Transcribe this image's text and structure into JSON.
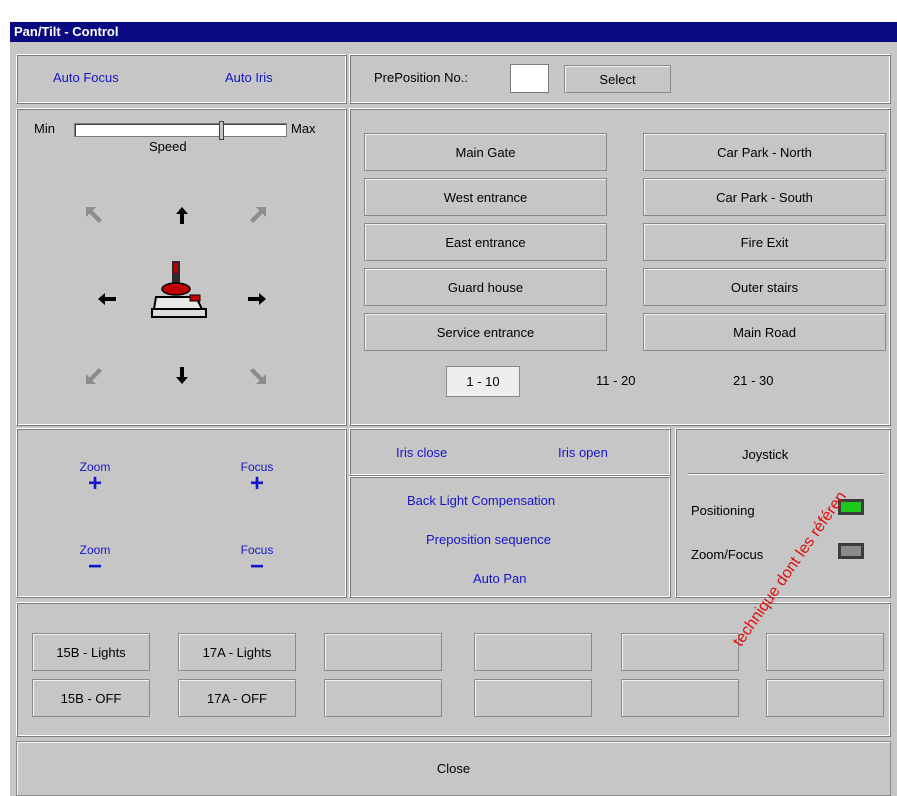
{
  "window": {
    "title": "Pan/Tilt - Control"
  },
  "top_left": {
    "auto_focus": "Auto Focus",
    "auto_iris": "Auto Iris"
  },
  "preposition": {
    "label": "PrePosition No.:",
    "value": "",
    "select": "Select"
  },
  "speed": {
    "min": "Min",
    "max": "Max",
    "label": "Speed",
    "level": 0.7
  },
  "direction_icons": [
    "arrow-up-left-icon",
    "arrow-up-icon",
    "arrow-up-right-icon",
    "arrow-left-icon",
    "joystick-icon",
    "arrow-right-icon",
    "arrow-down-left-icon",
    "arrow-down-icon",
    "arrow-down-right-icon"
  ],
  "presets": {
    "left": [
      "Main Gate",
      "West entrance",
      "East entrance",
      "Guard house",
      "Service entrance"
    ],
    "right": [
      "Car Park - North",
      "Car Park - South",
      "Fire Exit",
      "Outer stairs",
      "Main Road"
    ],
    "pages": [
      "1 - 10",
      "11 - 20",
      "21 - 30"
    ],
    "active_page": "1 - 10"
  },
  "zoom_focus": {
    "zoom": "Zoom",
    "focus": "Focus",
    "plus": "+",
    "minus": "−"
  },
  "iris": {
    "close": "Iris close",
    "open": "Iris open"
  },
  "functions": {
    "blc": "Back Light Compensation",
    "sequence": "Preposition sequence",
    "autopan": "Auto Pan"
  },
  "joystick": {
    "title": "Joystick",
    "positioning": "Positioning",
    "zoom_focus": "Zoom/Focus",
    "positioning_on": true,
    "zoom_focus_on": false,
    "colors": {
      "on": "#1ec81e",
      "off": "#8a8a8a"
    }
  },
  "aux": {
    "row1": [
      "15B - Lights",
      "17A - Lights"
    ],
    "row2": [
      "15B - OFF",
      "17A - OFF"
    ]
  },
  "close": "Close",
  "watermark": "technique dont les référen",
  "colors": {
    "title_bar": "#0a0a80",
    "link": "#1515c8",
    "background": "#c6c6c6",
    "watermark": "#e01010"
  }
}
